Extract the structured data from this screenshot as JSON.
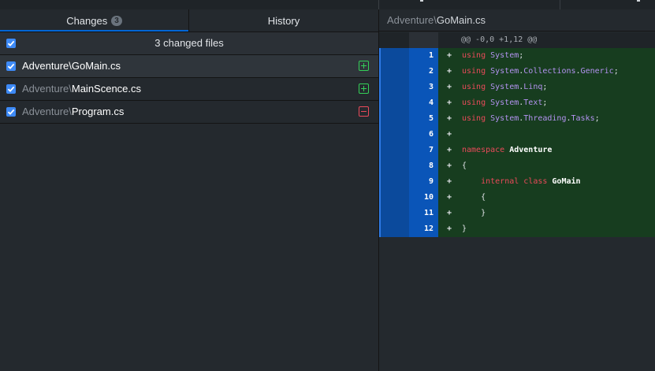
{
  "tabs": {
    "changes_label": "Changes",
    "changes_count": "3",
    "history_label": "History"
  },
  "summary": {
    "label": "3 changed files"
  },
  "files": [
    {
      "dir": "Adventure\\",
      "name": "GoMain.cs",
      "status": "added",
      "selected": true
    },
    {
      "dir": "Adventure\\",
      "name": "MainScence.cs",
      "status": "added",
      "selected": false
    },
    {
      "dir": "Adventure\\",
      "name": "Program.cs",
      "status": "deleted",
      "selected": false
    }
  ],
  "diff": {
    "header_dir": "Adventure\\",
    "header_name": "GoMain.cs",
    "hunk": "@@ -0,0 +1,12 @@",
    "lines": [
      {
        "num": "1",
        "sign": "+",
        "tokens": [
          [
            "kw",
            "using "
          ],
          [
            "ty",
            "System"
          ],
          [
            "pu",
            ";"
          ]
        ]
      },
      {
        "num": "2",
        "sign": "+",
        "tokens": [
          [
            "kw",
            "using "
          ],
          [
            "ty",
            "System"
          ],
          [
            "pu",
            "."
          ],
          [
            "ty",
            "Collections"
          ],
          [
            "pu",
            "."
          ],
          [
            "ty",
            "Generic"
          ],
          [
            "pu",
            ";"
          ]
        ]
      },
      {
        "num": "3",
        "sign": "+",
        "tokens": [
          [
            "kw",
            "using "
          ],
          [
            "ty",
            "System"
          ],
          [
            "pu",
            "."
          ],
          [
            "ty",
            "Linq"
          ],
          [
            "pu",
            ";"
          ]
        ]
      },
      {
        "num": "4",
        "sign": "+",
        "tokens": [
          [
            "kw",
            "using "
          ],
          [
            "ty",
            "System"
          ],
          [
            "pu",
            "."
          ],
          [
            "ty",
            "Text"
          ],
          [
            "pu",
            ";"
          ]
        ]
      },
      {
        "num": "5",
        "sign": "+",
        "tokens": [
          [
            "kw",
            "using "
          ],
          [
            "ty",
            "System"
          ],
          [
            "pu",
            "."
          ],
          [
            "ty",
            "Threading"
          ],
          [
            "pu",
            "."
          ],
          [
            "ty",
            "Tasks"
          ],
          [
            "pu",
            ";"
          ]
        ]
      },
      {
        "num": "6",
        "sign": "+",
        "tokens": []
      },
      {
        "num": "7",
        "sign": "+",
        "tokens": [
          [
            "kw",
            "namespace "
          ],
          [
            "bd",
            "Adventure"
          ]
        ]
      },
      {
        "num": "8",
        "sign": "+",
        "tokens": [
          [
            "pu",
            "{"
          ]
        ]
      },
      {
        "num": "9",
        "sign": "+",
        "tokens": [
          [
            "pl",
            "    "
          ],
          [
            "kw",
            "internal class "
          ],
          [
            "bd",
            "GoMain"
          ]
        ]
      },
      {
        "num": "10",
        "sign": "+",
        "tokens": [
          [
            "pl",
            "    "
          ],
          [
            "pu",
            "{"
          ]
        ]
      },
      {
        "num": "11",
        "sign": "+",
        "tokens": [
          [
            "pl",
            "    "
          ],
          [
            "pu",
            "}"
          ]
        ]
      },
      {
        "num": "12",
        "sign": "+",
        "tokens": [
          [
            "pu",
            "}"
          ]
        ]
      }
    ]
  },
  "colors": {
    "accent": "#0366d6",
    "added": "#34d058",
    "deleted": "#ea4a5a"
  }
}
